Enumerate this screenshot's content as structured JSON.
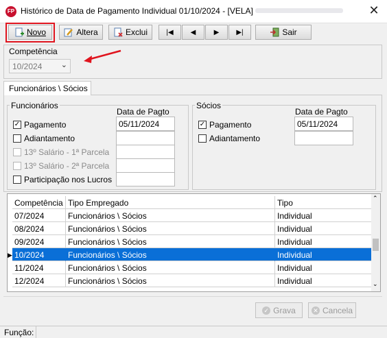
{
  "window": {
    "title": "Histórico de Data de Pagamento Individual  01/10/2024 - [VELA] -",
    "app_icon_text": "FP",
    "close_glyph": "✕"
  },
  "toolbar": {
    "novo": "Novo",
    "altera": "Altera",
    "exclui": "Exclui",
    "first": "|◀",
    "prev": "◀",
    "next": "▶",
    "last": "▶|",
    "sair": "Sair"
  },
  "competencia": {
    "label": "Competência",
    "value": "10/2024"
  },
  "tab": {
    "label": "Funcionários \\ Sócios"
  },
  "funcionarios": {
    "title": "Funcionários",
    "date_header": "Data de Pagto",
    "items": [
      {
        "label": "Pagamento",
        "checked": true,
        "enabled": true,
        "date": "05/11/2024"
      },
      {
        "label": "Adiantamento",
        "checked": false,
        "enabled": true,
        "date": ""
      },
      {
        "label": "13º Salário - 1ª Parcela",
        "checked": false,
        "enabled": false,
        "date": ""
      },
      {
        "label": "13º Salário - 2ª Parcela",
        "checked": false,
        "enabled": false,
        "date": ""
      },
      {
        "label": "Participação nos Lucros",
        "checked": false,
        "enabled": true,
        "date": ""
      }
    ]
  },
  "socios": {
    "title": "Sócios",
    "date_header": "Data de Pagto",
    "items": [
      {
        "label": "Pagamento",
        "checked": true,
        "date": "05/11/2024"
      },
      {
        "label": "Adiantamento",
        "checked": false,
        "date": ""
      }
    ]
  },
  "grid": {
    "columns": [
      "Competência",
      "Tipo Empregado",
      "Tipo"
    ],
    "rows": [
      [
        "07/2024",
        "Funcionários \\ Sócios",
        "Individual"
      ],
      [
        "08/2024",
        "Funcionários \\ Sócios",
        "Individual"
      ],
      [
        "09/2024",
        "Funcionários \\ Sócios",
        "Individual"
      ],
      [
        "10/2024",
        "Funcionários \\ Sócios",
        "Individual"
      ],
      [
        "11/2024",
        "Funcionários \\ Sócios",
        "Individual"
      ],
      [
        "12/2024",
        "Funcionários \\ Sócios",
        "Individual"
      ]
    ],
    "selected_row": 3
  },
  "footer": {
    "grava": "Grava",
    "cancela": "Cancela",
    "funcao_label": "Função:"
  },
  "colors": {
    "highlight": "#e0141e",
    "selection": "#0a6fd7",
    "arrow": "#e0141e"
  }
}
